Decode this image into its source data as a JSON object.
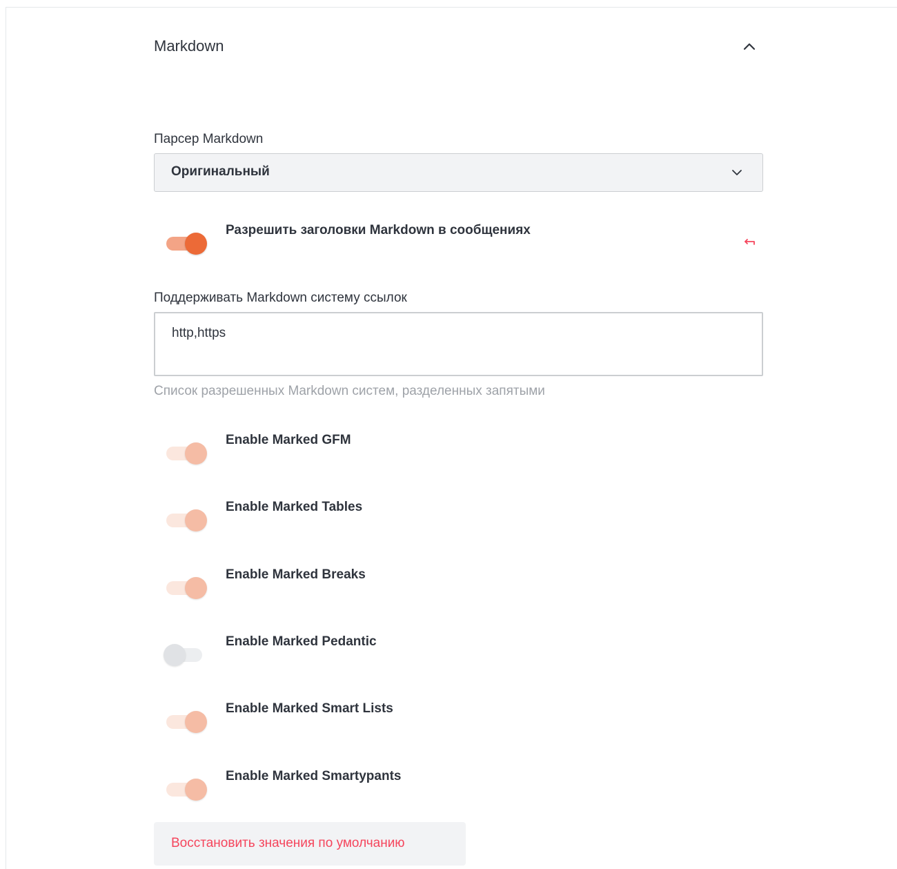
{
  "section": {
    "title": "Markdown",
    "collapse_icon": "chevron-up-icon"
  },
  "parser": {
    "label": "Парсер Markdown",
    "selected": "Оригинальный",
    "dropdown_icon": "chevron-down-icon"
  },
  "headers_toggle": {
    "label": "Разрешить заголовки Markdown в сообщениях",
    "enabled": true,
    "reset_icon": "undo-arrow-icon"
  },
  "link_schemes": {
    "label": "Поддерживать Markdown систему ссылок",
    "value": "http,https",
    "hint": "Список разрешенных Markdown систем, разделенных запятыми"
  },
  "marked_options": [
    {
      "label": "Enable Marked GFM",
      "enabled": true
    },
    {
      "label": "Enable Marked Tables",
      "enabled": true
    },
    {
      "label": "Enable Marked Breaks",
      "enabled": true
    },
    {
      "label": "Enable Marked Pedantic",
      "enabled": false
    },
    {
      "label": "Enable Marked Smart Lists",
      "enabled": true
    },
    {
      "label": "Enable Marked Smartypants",
      "enabled": true
    }
  ],
  "reset_button": {
    "label": "Восстановить значения по умолчанию"
  },
  "colors": {
    "accent": "#ec6a37",
    "danger": "#f5455c",
    "text": "#2f343d",
    "hint": "#9ea2a8"
  }
}
